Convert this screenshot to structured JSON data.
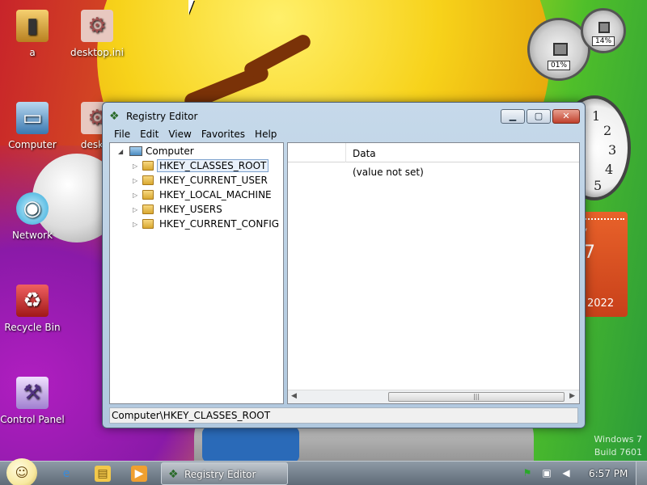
{
  "desktop": {
    "icons": [
      {
        "label": "a",
        "icon": "folder-user-icon"
      },
      {
        "label": "desktop.ini",
        "icon": "settings-file-icon"
      },
      {
        "label": "Computer",
        "icon": "computer-icon"
      },
      {
        "label": "deskto",
        "icon": "settings-file-icon"
      },
      {
        "label": "Network",
        "icon": "network-icon"
      },
      {
        "label": "Recycle Bin",
        "icon": "recycle-bin-icon"
      },
      {
        "label": "Control Panel",
        "icon": "control-panel-icon"
      }
    ],
    "watermark": {
      "line1": "Windows 7",
      "line2": "Build 7601"
    }
  },
  "gadgets": {
    "cpu_meter": {
      "cpu": "01%",
      "memory": "14%"
    },
    "clock": {
      "numerals": [
        "1",
        "2",
        "3",
        "4",
        "5"
      ]
    },
    "calendar": {
      "year": "2022",
      "month_stub": "y",
      "day_stub": "7"
    }
  },
  "window": {
    "title": "Registry Editor",
    "menu": [
      "File",
      "Edit",
      "View",
      "Favorites",
      "Help"
    ],
    "tree": {
      "root": "Computer",
      "items": [
        {
          "label": "HKEY_CLASSES_ROOT",
          "selected": true
        },
        {
          "label": "HKEY_CURRENT_USER",
          "selected": false
        },
        {
          "label": "HKEY_LOCAL_MACHINE",
          "selected": false
        },
        {
          "label": "HKEY_USERS",
          "selected": false
        },
        {
          "label": "HKEY_CURRENT_CONFIG",
          "selected": false
        }
      ]
    },
    "data_pane": {
      "columns": [
        "",
        "Data"
      ],
      "rows": [
        {
          "data": "(value not set)"
        }
      ]
    },
    "status": "Computer\\HKEY_CLASSES_ROOT"
  },
  "taskbar": {
    "task_label": "Registry Editor",
    "time": "6:57 PM",
    "pinned": [
      "internet-explorer-icon",
      "explorer-folder-icon",
      "media-player-icon"
    ],
    "tray": [
      "action-center-icon",
      "network-tray-icon",
      "volume-muted-icon"
    ]
  }
}
